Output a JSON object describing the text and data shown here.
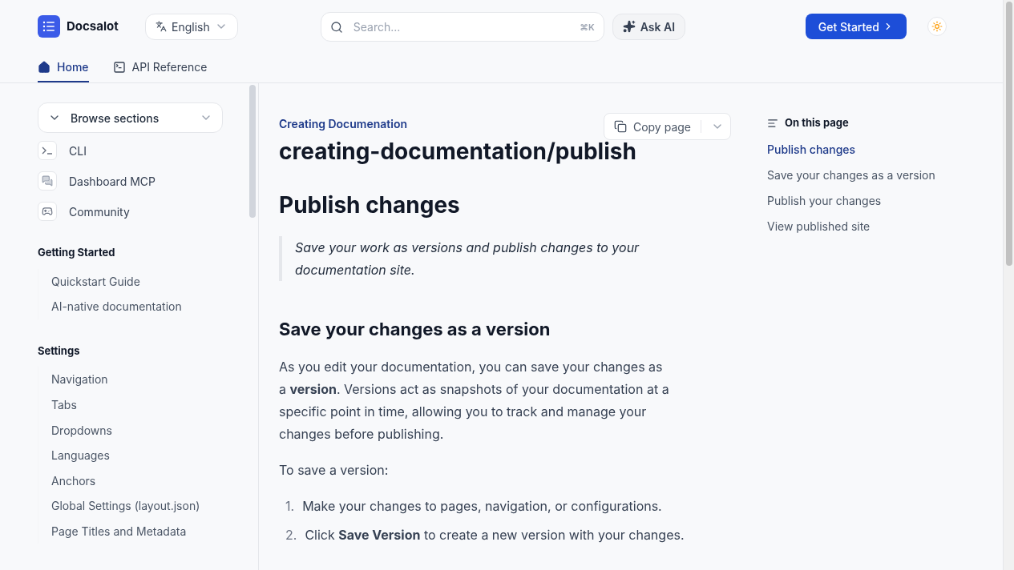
{
  "header": {
    "logo": "Docsalot",
    "language": "English",
    "search": {
      "placeholder": "Search...",
      "shortcut": "⌘K"
    },
    "ask_ai": "Ask AI",
    "cta": "Get Started",
    "theme_toggle": {
      "on": false
    }
  },
  "tabs": [
    {
      "label": "Home",
      "selected": true,
      "kind": "home"
    },
    {
      "label": "API Reference",
      "selected": false,
      "kind": "terminal"
    }
  ],
  "sidebar": {
    "dropdown": "Browse sections",
    "links": [
      {
        "label": "CLI",
        "kind": "terminal"
      },
      {
        "label": "Dashboard MCP",
        "kind": "chat"
      },
      {
        "label": "Community",
        "kind": "discord"
      }
    ],
    "groups": [
      {
        "title": "Getting Started",
        "items": [
          {
            "label": "Quickstart Guide",
            "selected": false
          },
          {
            "label": "AI-native documentation",
            "selected": false
          }
        ]
      },
      {
        "title": "Settings",
        "items": [
          {
            "label": "Navigation",
            "selected": false
          },
          {
            "label": "Tabs",
            "selected": false
          },
          {
            "label": "Dropdowns",
            "selected": false
          },
          {
            "label": "Languages",
            "selected": false
          },
          {
            "label": "Anchors",
            "selected": false
          },
          {
            "label": "Global Settings (layout.json)",
            "selected": false
          },
          {
            "label": "Page Titles and Metadata",
            "selected": false
          }
        ]
      }
    ]
  },
  "content": {
    "breadcrumb": "Creating Documenation",
    "copy_button": "Copy page",
    "path_title": "creating-documentation/publish",
    "heading": "Publish changes",
    "quote": "Save your work as versions and publish changes to your documentation site.",
    "section_heading": "Save your changes as a version",
    "paragraph": "As you edit your documentation, you can save your changes as a **version**. Versions act as snapshots of your documentation at a specific point in time, allowing you to track and manage your changes before publishing.",
    "lead": "To save a version:",
    "steps": [
      {
        "number": "1.",
        "text": "Make your changes to pages, navigation, or configurations."
      },
      {
        "number": "2.",
        "text": "Click **Save Version** to create a new version with your changes."
      }
    ]
  },
  "toc": {
    "title": "On this page",
    "items": [
      {
        "label": "Publish changes",
        "selected": true
      },
      {
        "label": "Save your changes as a version",
        "selected": false
      },
      {
        "label": "Publish your changes",
        "selected": false
      },
      {
        "label": "View published site",
        "selected": false
      }
    ]
  }
}
